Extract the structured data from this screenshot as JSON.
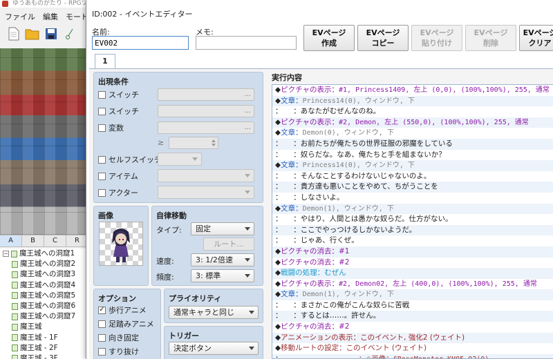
{
  "main_window": {
    "title": "ゆうあものがたり - RPGツクールMV",
    "menu": [
      "ファイル",
      "編集",
      "モード"
    ],
    "tile_tabs": [
      "A",
      "B",
      "C",
      "R"
    ],
    "map_tree": [
      {
        "label": "魔王城への洞窟1",
        "expander": "−"
      },
      {
        "label": "魔王城への洞窟2"
      },
      {
        "label": "魔王城への洞窟3"
      },
      {
        "label": "魔王城への洞窟4"
      },
      {
        "label": "魔王城への洞窟5"
      },
      {
        "label": "魔王城への洞窟6"
      },
      {
        "label": "魔王城への洞窟7"
      },
      {
        "label": "魔王城"
      },
      {
        "label": "魔王城 - 1F"
      },
      {
        "label": "魔王城 - 2F"
      },
      {
        "label": "魔王城 - 3F"
      }
    ]
  },
  "dialog": {
    "title": "ID:002 - イベントエディター",
    "name_label": "名前:",
    "name_value": "EV002",
    "memo_label": "メモ:",
    "memo_value": "",
    "buttons": [
      {
        "label": "EVページ\n作成",
        "enabled": true
      },
      {
        "label": "EVページ\nコピー",
        "enabled": true
      },
      {
        "label": "EVページ\n貼り付け",
        "enabled": false
      },
      {
        "label": "EVページ\n削除",
        "enabled": false
      },
      {
        "label": "EVページ\nクリア",
        "enabled": true
      }
    ],
    "page_tab": "1"
  },
  "conditions": {
    "title": "出現条件",
    "switch1": "スイッチ",
    "switch2": "スイッチ",
    "variable": "変数",
    "ge": "≥",
    "self_switch": "セルフスイッチ",
    "item": "アイテム",
    "actor": "アクター",
    "dots": "..."
  },
  "image": {
    "title": "画像"
  },
  "autonomous": {
    "title": "自律移動",
    "type_label": "タイプ:",
    "type_value": "固定",
    "route_button": "ルート...",
    "speed_label": "速度:",
    "speed_value": "3: 1/2倍速",
    "freq_label": "頻度:",
    "freq_value": "3: 標準"
  },
  "options": {
    "title": "オプション",
    "items": [
      {
        "label": "歩行アニメ",
        "checked": true
      },
      {
        "label": "足踏みアニメ",
        "checked": false
      },
      {
        "label": "向き固定",
        "checked": false
      },
      {
        "label": "すり抜け",
        "checked": false
      }
    ]
  },
  "priority": {
    "title": "プライオリティ",
    "value": "通常キャラと同じ"
  },
  "trigger": {
    "title": "トリガー",
    "value": "決定ボタン"
  },
  "execution": {
    "title": "実行内容",
    "lines": [
      {
        "lead": "◆",
        "text": "ピクチャの表示：",
        "mono": "#1, Princess1409, 左上 (0,0), (100%,100%), 255, 通常",
        "cls": "c-purple"
      },
      {
        "lead": "◆",
        "text": "文章：",
        "mono": "Princess14(0), ウィンドウ, 下",
        "cls": "c-blue",
        "monocls": "c-gray"
      },
      {
        "lead": "：",
        "text": "　　：あなたがむぜんなのね。",
        "cls": "c-black"
      },
      {
        "lead": "◆",
        "text": "ピクチャの表示：",
        "mono": "#2, Demon, 左上 (550,0), (100%,100%), 255, 通常",
        "cls": "c-purple"
      },
      {
        "lead": "◆",
        "text": "文章：",
        "mono": "Demon(0), ウィンドウ, 下",
        "cls": "c-blue",
        "monocls": "c-gray"
      },
      {
        "lead": "：",
        "text": "　　：お前たちが俺たちの世界征服の邪魔をしている",
        "cls": "c-black"
      },
      {
        "lead": "：",
        "text": "　　：奴らだな。なあ、俺たちと手を組まないか？",
        "cls": "c-black"
      },
      {
        "lead": "◆",
        "text": "文章：",
        "mono": "Princess14(0), ウィンドウ, 下",
        "cls": "c-blue",
        "monocls": "c-gray"
      },
      {
        "lead": "：",
        "text": "　　：そんなことするわけないじゃないのよ。",
        "cls": "c-black"
      },
      {
        "lead": "：",
        "text": "　　：貴方達も悪いことをやめて、ちがうことを",
        "cls": "c-black"
      },
      {
        "lead": "：",
        "text": "　　：しなさいよ。",
        "cls": "c-black"
      },
      {
        "lead": "◆",
        "text": "文章：",
        "mono": "Demon(1), ウィンドウ, 下",
        "cls": "c-blue",
        "monocls": "c-gray"
      },
      {
        "lead": "：",
        "text": "　　：やはり、人間とは愚かな奴らだ。仕方がない。",
        "cls": "c-black"
      },
      {
        "lead": "：",
        "text": "　　：ここでやっつけるしかないようだ。",
        "cls": "c-black"
      },
      {
        "lead": "：",
        "text": "　　：じゃあ、行くぜ。",
        "cls": "c-black"
      },
      {
        "lead": "◆",
        "text": "ピクチャの消去：#1",
        "cls": "c-purple"
      },
      {
        "lead": "◆",
        "text": "ピクチャの消去：#2",
        "cls": "c-purple"
      },
      {
        "lead": "◆",
        "text": "戦闘の処理：むぜん",
        "cls": "c-cyan"
      },
      {
        "lead": "◆",
        "text": "ピクチャの表示：",
        "mono": "#2, Demon02, 左上 (400,0), (100%,100%), 255, 通常",
        "cls": "c-purple"
      },
      {
        "lead": "◆",
        "text": "文章：",
        "mono": "Demon(1), ウィンドウ, 下",
        "cls": "c-blue",
        "monocls": "c-gray"
      },
      {
        "lead": "：",
        "text": "　　：まさかこの俺がこんな奴らに苦戦",
        "cls": "c-black"
      },
      {
        "lead": "：",
        "text": "　　：するとは……。許せん。",
        "cls": "c-black"
      },
      {
        "lead": "◆",
        "text": "ピクチャの消去：#2",
        "cls": "c-purple"
      },
      {
        "lead": "◆",
        "text": "アニメーションの表示：このイベント, 強化2 (ウェイト)",
        "cls": "c-red"
      },
      {
        "lead": "◆",
        "text": "移動ルートの設定：このイベント (ウェイト)",
        "cls": "c-dkred"
      },
      {
        "lead": "：",
        "text": "　　　　　　　　　　　：◇画像：",
        "mono": "$BossMonster_KH05_02(0)",
        "cls": "c-dkred"
      }
    ]
  }
}
